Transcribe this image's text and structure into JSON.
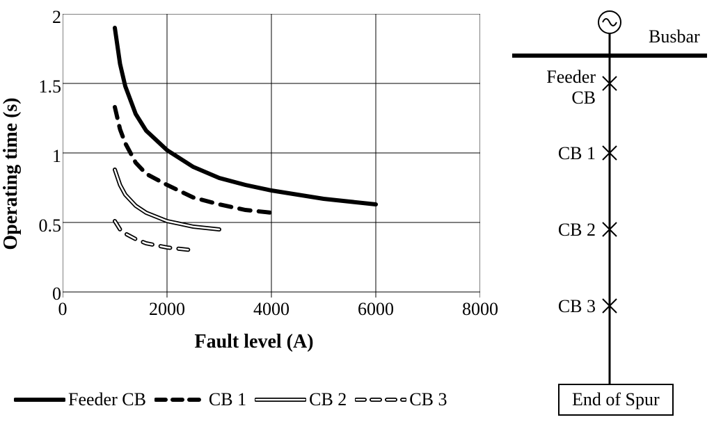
{
  "chart_data": {
    "type": "line",
    "xlabel": "Fault level (A)",
    "ylabel": "Operating time (s)",
    "xlim": [
      0,
      8000
    ],
    "ylim": [
      0,
      2
    ],
    "xticks": [
      0,
      2000,
      4000,
      6000,
      8000
    ],
    "yticks": [
      0,
      0.5,
      1,
      1.5,
      2
    ],
    "grid": true,
    "series": [
      {
        "name": "Feeder CB",
        "style": "solid-thick",
        "x": [
          1000,
          1100,
          1200,
          1400,
          1600,
          2000,
          2500,
          3000,
          3500,
          4000,
          4500,
          5000,
          5500,
          6000
        ],
        "y": [
          1.9,
          1.64,
          1.48,
          1.28,
          1.16,
          1.02,
          0.9,
          0.82,
          0.77,
          0.73,
          0.7,
          0.67,
          0.65,
          0.63
        ]
      },
      {
        "name": "CB 1",
        "style": "dashed-thick",
        "x": [
          1000,
          1100,
          1200,
          1400,
          1600,
          2000,
          2500,
          3000,
          3500,
          4000
        ],
        "y": [
          1.33,
          1.17,
          1.07,
          0.93,
          0.85,
          0.77,
          0.68,
          0.63,
          0.59,
          0.57
        ]
      },
      {
        "name": "CB 2",
        "style": "double-line",
        "x": [
          1000,
          1100,
          1200,
          1400,
          1600,
          2000,
          2500,
          3000
        ],
        "y": [
          0.88,
          0.77,
          0.7,
          0.62,
          0.57,
          0.51,
          0.47,
          0.45
        ]
      },
      {
        "name": "CB 3",
        "style": "dashed-open",
        "x": [
          1000,
          1100,
          1200,
          1400,
          1600,
          2000,
          2500
        ],
        "y": [
          0.51,
          0.45,
          0.42,
          0.38,
          0.35,
          0.32,
          0.3
        ]
      }
    ],
    "legend_position": "bottom"
  },
  "diagram": {
    "source_label": "",
    "busbar_label": "Busbar",
    "nodes": [
      {
        "label1": "Feeder",
        "label2": "CB"
      },
      {
        "label1": "CB 1",
        "label2": ""
      },
      {
        "label1": "CB 2",
        "label2": ""
      },
      {
        "label1": "CB 3",
        "label2": ""
      }
    ],
    "terminal_label": "End of Spur"
  },
  "legend": {
    "items": [
      "Feeder CB",
      "CB 1",
      "CB 2",
      "CB 3"
    ]
  }
}
